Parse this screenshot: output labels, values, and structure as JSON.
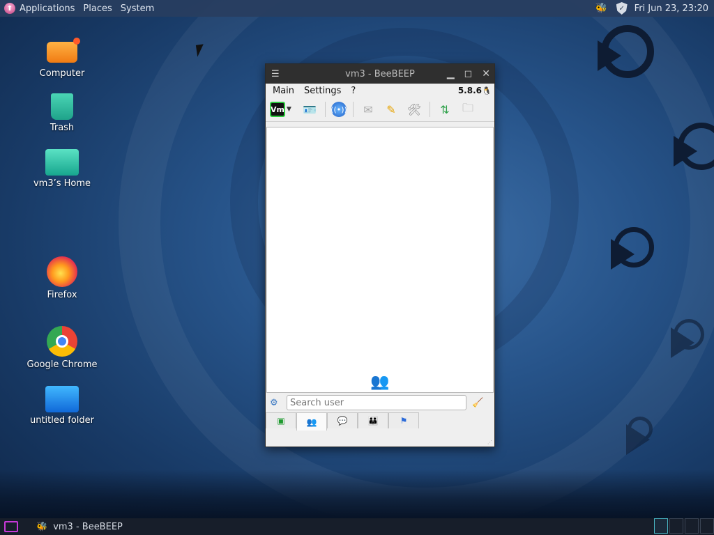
{
  "top_panel": {
    "menus": [
      "Applications",
      "Places",
      "System"
    ],
    "clock": "Fri Jun 23, 23:20",
    "tray_icons": [
      "beebeep-bee-icon",
      "shield-icon"
    ]
  },
  "desktop": {
    "icons": [
      {
        "label": "Computer",
        "icon": "computer-icon"
      },
      {
        "label": "Trash",
        "icon": "trash-icon"
      },
      {
        "label": "vm3’s Home",
        "icon": "home-folder-icon"
      },
      {
        "label": "Firefox",
        "icon": "firefox-icon"
      },
      {
        "label": "Google Chrome",
        "icon": "chrome-icon"
      },
      {
        "label": "untitled folder",
        "icon": "folder-icon"
      }
    ]
  },
  "window": {
    "title": "vm3 - BeeBEEP",
    "menubar": {
      "items": [
        "Main",
        "Settings",
        "?"
      ],
      "version": "5.8.6"
    },
    "toolbar": {
      "status_badge": "Vm",
      "buttons": [
        "edit-profile-icon",
        "network-icon",
        "message-icon",
        "edit-icon",
        "tools-icon",
        "update-icon",
        "folder-icon"
      ]
    },
    "search": {
      "placeholder": "Search user",
      "value": ""
    },
    "tabs": [
      "status-tab",
      "users-tab",
      "chats-tab",
      "groups-tab",
      "shares-tab"
    ],
    "active_tab": 1
  },
  "taskbar": {
    "task_title": "vm3 - BeeBEEP",
    "workspace_count": 4,
    "active_workspace": 0
  },
  "colors": {
    "accent": "#c738d8",
    "panel": "#171e2a",
    "titlebar": "#2f2f2f"
  }
}
